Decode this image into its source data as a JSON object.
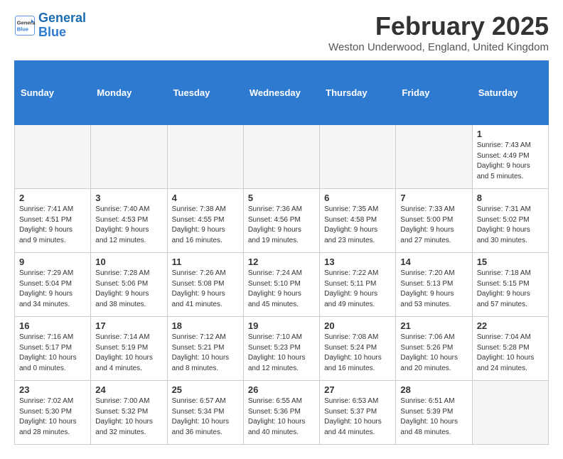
{
  "header": {
    "logo_line1": "General",
    "logo_line2": "Blue",
    "title": "February 2025",
    "location": "Weston Underwood, England, United Kingdom"
  },
  "weekdays": [
    "Sunday",
    "Monday",
    "Tuesday",
    "Wednesday",
    "Thursday",
    "Friday",
    "Saturday"
  ],
  "weeks": [
    [
      {
        "day": "",
        "info": ""
      },
      {
        "day": "",
        "info": ""
      },
      {
        "day": "",
        "info": ""
      },
      {
        "day": "",
        "info": ""
      },
      {
        "day": "",
        "info": ""
      },
      {
        "day": "",
        "info": ""
      },
      {
        "day": "1",
        "info": "Sunrise: 7:43 AM\nSunset: 4:49 PM\nDaylight: 9 hours and 5 minutes."
      }
    ],
    [
      {
        "day": "2",
        "info": "Sunrise: 7:41 AM\nSunset: 4:51 PM\nDaylight: 9 hours and 9 minutes."
      },
      {
        "day": "3",
        "info": "Sunrise: 7:40 AM\nSunset: 4:53 PM\nDaylight: 9 hours and 12 minutes."
      },
      {
        "day": "4",
        "info": "Sunrise: 7:38 AM\nSunset: 4:55 PM\nDaylight: 9 hours and 16 minutes."
      },
      {
        "day": "5",
        "info": "Sunrise: 7:36 AM\nSunset: 4:56 PM\nDaylight: 9 hours and 19 minutes."
      },
      {
        "day": "6",
        "info": "Sunrise: 7:35 AM\nSunset: 4:58 PM\nDaylight: 9 hours and 23 minutes."
      },
      {
        "day": "7",
        "info": "Sunrise: 7:33 AM\nSunset: 5:00 PM\nDaylight: 9 hours and 27 minutes."
      },
      {
        "day": "8",
        "info": "Sunrise: 7:31 AM\nSunset: 5:02 PM\nDaylight: 9 hours and 30 minutes."
      }
    ],
    [
      {
        "day": "9",
        "info": "Sunrise: 7:29 AM\nSunset: 5:04 PM\nDaylight: 9 hours and 34 minutes."
      },
      {
        "day": "10",
        "info": "Sunrise: 7:28 AM\nSunset: 5:06 PM\nDaylight: 9 hours and 38 minutes."
      },
      {
        "day": "11",
        "info": "Sunrise: 7:26 AM\nSunset: 5:08 PM\nDaylight: 9 hours and 41 minutes."
      },
      {
        "day": "12",
        "info": "Sunrise: 7:24 AM\nSunset: 5:10 PM\nDaylight: 9 hours and 45 minutes."
      },
      {
        "day": "13",
        "info": "Sunrise: 7:22 AM\nSunset: 5:11 PM\nDaylight: 9 hours and 49 minutes."
      },
      {
        "day": "14",
        "info": "Sunrise: 7:20 AM\nSunset: 5:13 PM\nDaylight: 9 hours and 53 minutes."
      },
      {
        "day": "15",
        "info": "Sunrise: 7:18 AM\nSunset: 5:15 PM\nDaylight: 9 hours and 57 minutes."
      }
    ],
    [
      {
        "day": "16",
        "info": "Sunrise: 7:16 AM\nSunset: 5:17 PM\nDaylight: 10 hours and 0 minutes."
      },
      {
        "day": "17",
        "info": "Sunrise: 7:14 AM\nSunset: 5:19 PM\nDaylight: 10 hours and 4 minutes."
      },
      {
        "day": "18",
        "info": "Sunrise: 7:12 AM\nSunset: 5:21 PM\nDaylight: 10 hours and 8 minutes."
      },
      {
        "day": "19",
        "info": "Sunrise: 7:10 AM\nSunset: 5:23 PM\nDaylight: 10 hours and 12 minutes."
      },
      {
        "day": "20",
        "info": "Sunrise: 7:08 AM\nSunset: 5:24 PM\nDaylight: 10 hours and 16 minutes."
      },
      {
        "day": "21",
        "info": "Sunrise: 7:06 AM\nSunset: 5:26 PM\nDaylight: 10 hours and 20 minutes."
      },
      {
        "day": "22",
        "info": "Sunrise: 7:04 AM\nSunset: 5:28 PM\nDaylight: 10 hours and 24 minutes."
      }
    ],
    [
      {
        "day": "23",
        "info": "Sunrise: 7:02 AM\nSunset: 5:30 PM\nDaylight: 10 hours and 28 minutes."
      },
      {
        "day": "24",
        "info": "Sunrise: 7:00 AM\nSunset: 5:32 PM\nDaylight: 10 hours and 32 minutes."
      },
      {
        "day": "25",
        "info": "Sunrise: 6:57 AM\nSunset: 5:34 PM\nDaylight: 10 hours and 36 minutes."
      },
      {
        "day": "26",
        "info": "Sunrise: 6:55 AM\nSunset: 5:36 PM\nDaylight: 10 hours and 40 minutes."
      },
      {
        "day": "27",
        "info": "Sunrise: 6:53 AM\nSunset: 5:37 PM\nDaylight: 10 hours and 44 minutes."
      },
      {
        "day": "28",
        "info": "Sunrise: 6:51 AM\nSunset: 5:39 PM\nDaylight: 10 hours and 48 minutes."
      },
      {
        "day": "",
        "info": ""
      }
    ]
  ]
}
